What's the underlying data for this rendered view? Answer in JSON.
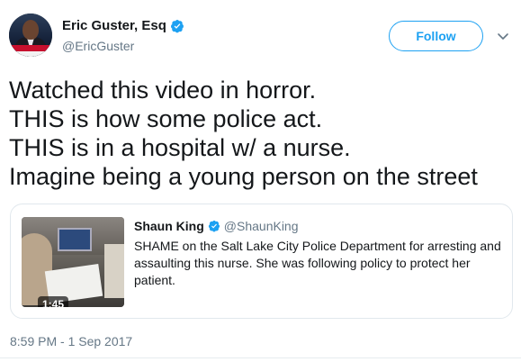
{
  "author": {
    "display_name": "Eric Guster, Esq",
    "handle": "@EricGuster",
    "verified": true,
    "avatar_icon": "profile-photo"
  },
  "actions": {
    "follow_label": "Follow",
    "menu_icon": "chevron-down-icon"
  },
  "tweet": {
    "lines": [
      "Watched this video in horror.",
      "THIS is how some police act.",
      "THIS is in a hospital w/ a nurse.",
      "Imagine being a young person on the street"
    ],
    "timestamp": "8:59 PM - 1 Sep 2017"
  },
  "quoted": {
    "display_name": "Shaun King",
    "handle": "@ShaunKing",
    "verified": true,
    "text": "SHAME on the Salt Lake City Police Department for arresting and assaulting this nurse. She was following policy to protect her patient.",
    "video_duration": "1:45"
  },
  "colors": {
    "accent": "#1da1f2",
    "secondary_text": "#657786",
    "border": "#e1e8ed"
  }
}
